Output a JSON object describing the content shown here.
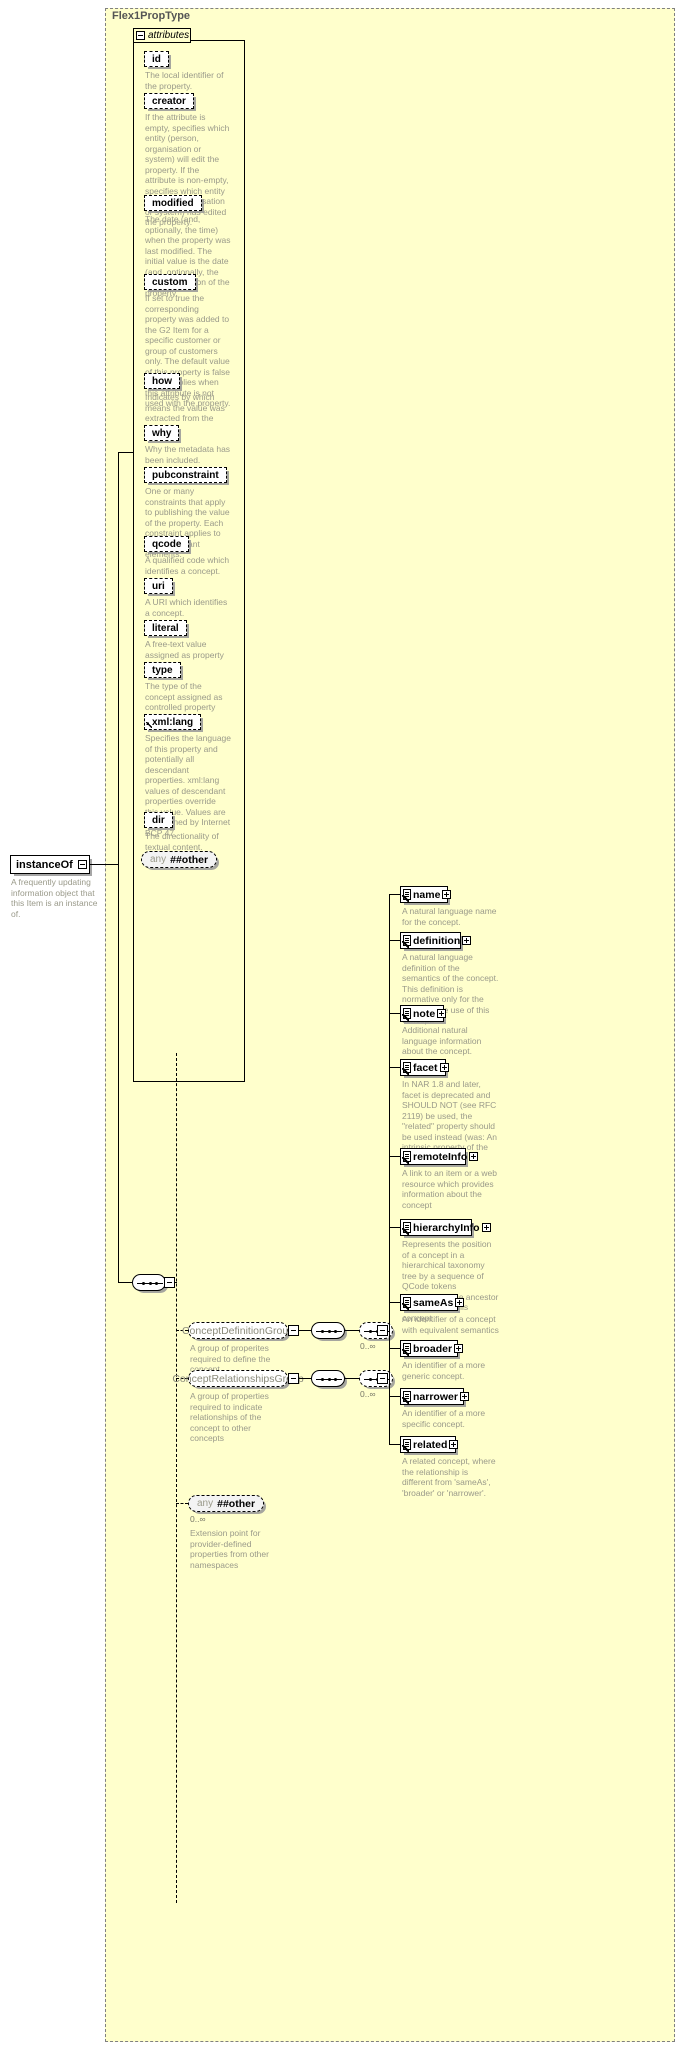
{
  "diagram": {
    "type_title": "Flex1PropType",
    "attributes_label": "attributes"
  },
  "attributes": [
    {
      "name": "id",
      "desc": "The local identifier of the property.",
      "ref": false
    },
    {
      "name": "creator",
      "desc": "If the attribute is empty, specifies which entity (person, organisation or system) will edit the property. If the attribute is non-empty, specifies which entity (person, organisation or system) has edited the property.",
      "ref": false
    },
    {
      "name": "modified",
      "desc": "The date (and, optionally, the time) when the property was last modified. The initial value is the date (and, optionally, the time) of creation of the property.",
      "ref": false
    },
    {
      "name": "custom",
      "desc": "If set to true the corresponding property was added to the G2 Item for a specific customer or group of customers only. The default value of this property is false which applies when this attribute is not used with the property.",
      "ref": false
    },
    {
      "name": "how",
      "desc": "Indicates by which means the value was extracted from the content.",
      "ref": false
    },
    {
      "name": "why",
      "desc": "Why the metadata has been included.",
      "ref": false
    },
    {
      "name": "pubconstraint",
      "desc": "One or many constraints that apply to publishing the value of the property. Each constraint applies to all descendant elements.",
      "ref": false
    },
    {
      "name": "qcode",
      "desc": "A qualified code which identifies a concept.",
      "ref": false
    },
    {
      "name": "uri",
      "desc": "A URI which identifies a concept.",
      "ref": false
    },
    {
      "name": "literal",
      "desc": "A free-text value assigned as property value.",
      "ref": false
    },
    {
      "name": "type",
      "desc": "The type of the concept assigned as controlled property value.",
      "ref": false
    },
    {
      "name": "xml:lang",
      "desc": "Specifies the language of this property and potentially all descendant properties. xml:lang values of descendant properties override this value. Values are determined by Internet BCP 47.",
      "ref": true
    },
    {
      "name": "dir",
      "desc": "The directionality of textual content.",
      "ref": false
    }
  ],
  "attributes_any": {
    "any_label": "any",
    "other_label": "##other"
  },
  "instance_of": {
    "name": "instanceOf",
    "desc": "A frequently updating information object that this Item is an instance of."
  },
  "concept_definition_group": {
    "name": "ConceptDefinitionGroup",
    "desc": "A group of properites required to define the concept",
    "occurs": "0..∞",
    "children": [
      {
        "name": "name",
        "desc": "A natural language name for the concept."
      },
      {
        "name": "definition",
        "desc": "A natural language definition of the semantics of the concept. This definition is normative only for the scope of the use of this concept."
      },
      {
        "name": "note",
        "desc": "Additional natural language information about the concept."
      },
      {
        "name": "facet",
        "desc": "In NAR 1.8 and later, facet is deprecated and SHOULD NOT (see RFC 2119) be used, the \"related\" property should be used instead (was: An intrinsic property of the concept.)"
      },
      {
        "name": "remoteInfo",
        "desc": "A link to an item or a web resource which provides information about the concept"
      },
      {
        "name": "hierarchyInfo",
        "desc": "Represents the position of a concept in a hierarchical taxonomy tree by a sequence of QCode tokens representing the ancestor concepts and this concept"
      }
    ]
  },
  "concept_relationships_group": {
    "name": "ConceptRelationshipsGroup",
    "desc": "A group of properties required to indicate relationships of the concept to other concepts",
    "occurs": "0..∞",
    "children": [
      {
        "name": "sameAs",
        "desc": "An identifier of a concept with equivalent semantics"
      },
      {
        "name": "broader",
        "desc": "An identifier of a more generic concept."
      },
      {
        "name": "narrower",
        "desc": "An identifier of a more specific concept."
      },
      {
        "name": "related",
        "desc": "A related concept, where the relationship is different from 'sameAs', 'broader' or 'narrower'."
      }
    ]
  },
  "extension_any": {
    "any_label": "any",
    "other_label": "##other",
    "occurs": "0..∞",
    "desc": "Extension point for provider-defined properties from other namespaces"
  }
}
